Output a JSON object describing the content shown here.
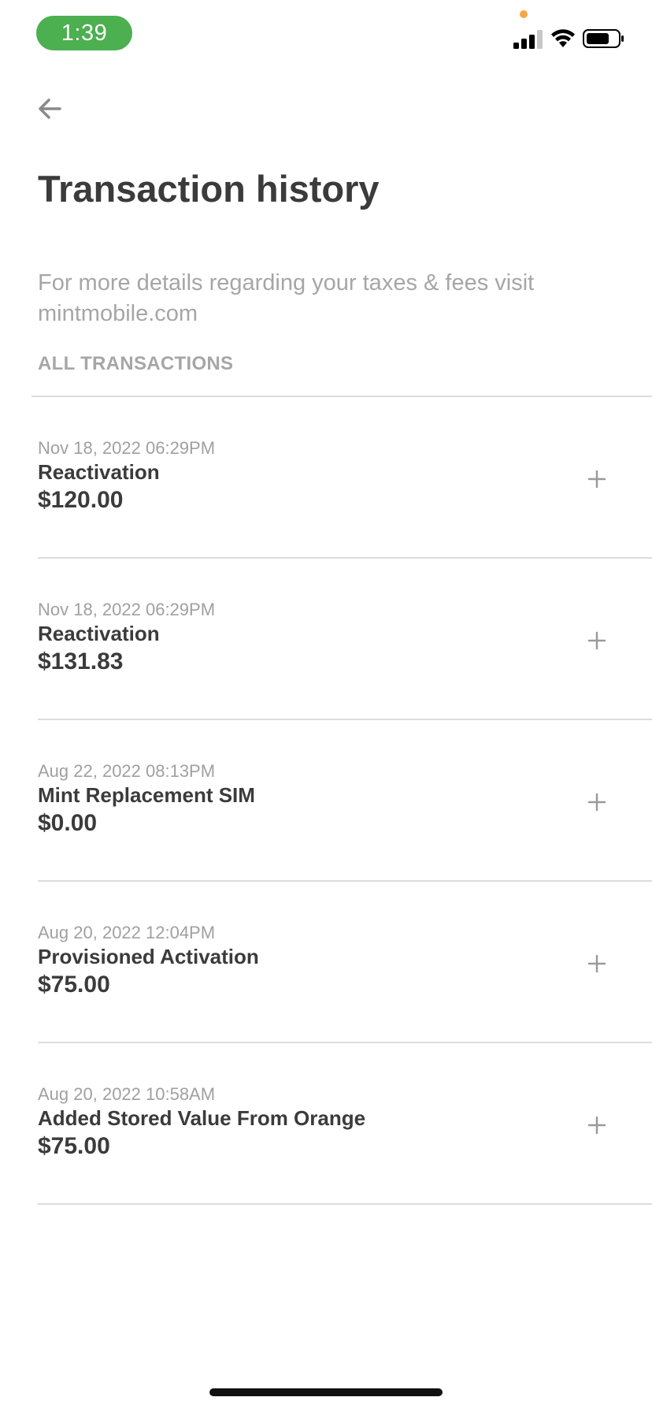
{
  "status_bar": {
    "time": "1:39",
    "privacy_dot_color": "#f4a742",
    "time_pill_color": "#4caf50",
    "icons": [
      "signal-icon",
      "wifi-icon",
      "battery-icon"
    ]
  },
  "nav": {
    "back_icon": "arrow-left-icon"
  },
  "header": {
    "title": "Transaction history"
  },
  "info": {
    "text": "For more details regarding your taxes & fees visit mintmobile.com"
  },
  "section": {
    "label": "ALL TRANSACTIONS"
  },
  "transactions": [
    {
      "date": "Nov 18, 2022 06:29PM",
      "name": "Reactivation",
      "amount": "$120.00"
    },
    {
      "date": "Nov 18, 2022 06:29PM",
      "name": "Reactivation",
      "amount": "$131.83"
    },
    {
      "date": "Aug 22, 2022 08:13PM",
      "name": "Mint Replacement SIM",
      "amount": "$0.00"
    },
    {
      "date": "Aug 20, 2022 12:04PM",
      "name": "Provisioned Activation",
      "amount": "$75.00"
    },
    {
      "date": "Aug 20, 2022 10:58AM",
      "name": "Added Stored Value From Orange",
      "amount": "$75.00"
    }
  ],
  "colors": {
    "text_primary": "#3b3b3b",
    "text_secondary": "#a6a6a6",
    "divider": "#dcdcdc",
    "expand_icon": "#9a9a9a"
  }
}
